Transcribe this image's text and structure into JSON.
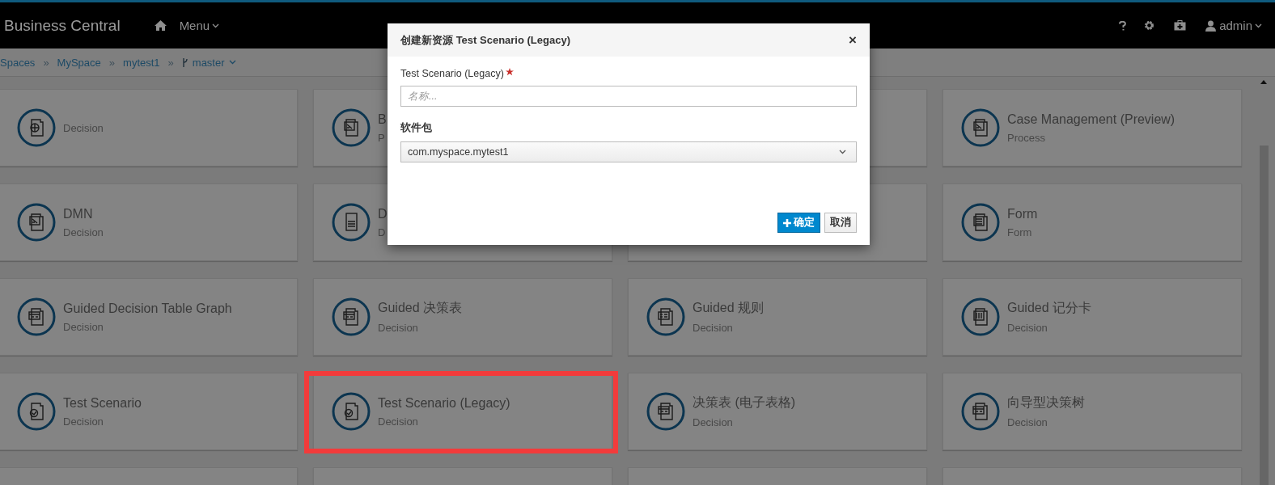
{
  "navbar": {
    "brand": "Business Central",
    "menu": "Menu",
    "user": "admin"
  },
  "breadcrumb": {
    "items": [
      "Spaces",
      "MySpace",
      "mytest1"
    ],
    "separator": "»",
    "branch": "master"
  },
  "cards": [
    {
      "kind": "globe",
      "subtitle": "Decision"
    },
    {
      "kind": "diagram",
      "title": "B",
      "subtitle": "P"
    },
    {
      "kind": "blank"
    },
    {
      "kind": "diagram",
      "title": "Case Management (Preview)",
      "subtitle": "Process"
    },
    {
      "kind": "diagram",
      "title": "DMN",
      "subtitle": "Decision"
    },
    {
      "kind": "report",
      "title": "D",
      "subtitle": "D"
    },
    {
      "kind": "blank"
    },
    {
      "kind": "form",
      "title": "Form",
      "subtitle": "Form"
    },
    {
      "kind": "table",
      "title": "Guided Decision Table Graph",
      "subtitle": "Decision"
    },
    {
      "kind": "table",
      "title": "Guided 决策表",
      "subtitle": "Decision"
    },
    {
      "kind": "rule",
      "title": "Guided 规则",
      "subtitle": "Decision"
    },
    {
      "kind": "score",
      "title": "Guided 记分卡",
      "subtitle": "Decision"
    },
    {
      "kind": "check",
      "title": "Test Scenario",
      "subtitle": "Decision"
    },
    {
      "kind": "check",
      "title": "Test Scenario (Legacy)",
      "subtitle": "Decision",
      "highlighted": true
    },
    {
      "kind": "table",
      "title": "决策表 (电子表格)",
      "subtitle": "Decision"
    },
    {
      "kind": "table",
      "title": "向导型决策树",
      "subtitle": "Decision"
    },
    {
      "kind": "blank"
    },
    {
      "kind": "blank"
    },
    {
      "kind": "blank"
    },
    {
      "kind": "blank"
    }
  ],
  "dialog": {
    "title_prefix": "创建新资源",
    "title": "Test Scenario (Legacy)",
    "close": "×",
    "name_label": "Test Scenario (Legacy)",
    "name_required": true,
    "name_placeholder": "名称...",
    "package_label": "软件包",
    "package_value": "com.myspace.mytest1",
    "buttons": [
      {
        "label": "确定",
        "kind": "primary"
      },
      {
        "label": "取消",
        "kind": "default"
      }
    ]
  }
}
